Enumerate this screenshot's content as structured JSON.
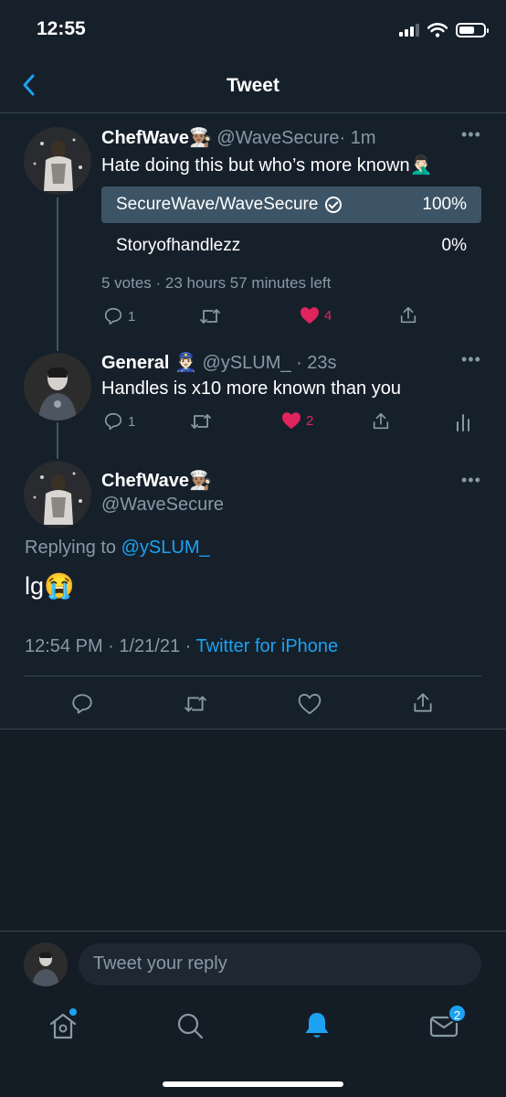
{
  "status_bar": {
    "time": "12:55"
  },
  "header": {
    "title": "Tweet"
  },
  "poll_tweet": {
    "name": "ChefWave",
    "name_emoji": "👨🏽‍🍳",
    "handle": "@WaveSecure",
    "time": "· 1m",
    "text": "Hate doing this but who’s more known",
    "text_emoji": "🤦🏻‍♂️",
    "poll": {
      "options": [
        {
          "label": "SecureWave/WaveSecure",
          "percent": "100%",
          "winner": true
        },
        {
          "label": "Storyofhandlezz",
          "percent": "0%",
          "winner": false
        }
      ],
      "votes": "5 votes",
      "time_left": "23 hours 57 minutes left"
    },
    "replies": "1",
    "likes": "4"
  },
  "reply_tweet": {
    "name": "General",
    "name_emoji": "👮🏻‍♂️",
    "handle": "@ySLUM_",
    "time": "· 23s",
    "text": "Handles is x10 more known than you",
    "replies": "1",
    "likes": "2"
  },
  "main_tweet": {
    "name": "ChefWave",
    "name_emoji": "👨🏽‍🍳",
    "handle": "@WaveSecure",
    "replying_prefix": "Replying to",
    "replying_to": "@ySLUM_",
    "text": "lg",
    "text_emoji": "😭",
    "timestamp": "12:54 PM · 1/21/21 ·",
    "source": "Twitter for iPhone"
  },
  "reply_input": {
    "placeholder": "Tweet your reply"
  },
  "tab_bar": {
    "messages_badge": "2"
  },
  "colors": {
    "background": "#15202b",
    "accent": "#1da1f2",
    "like": "#e0245e",
    "secondary_text": "#8899a6",
    "border": "#38444d",
    "poll_winner_fill": "#3d5466"
  }
}
